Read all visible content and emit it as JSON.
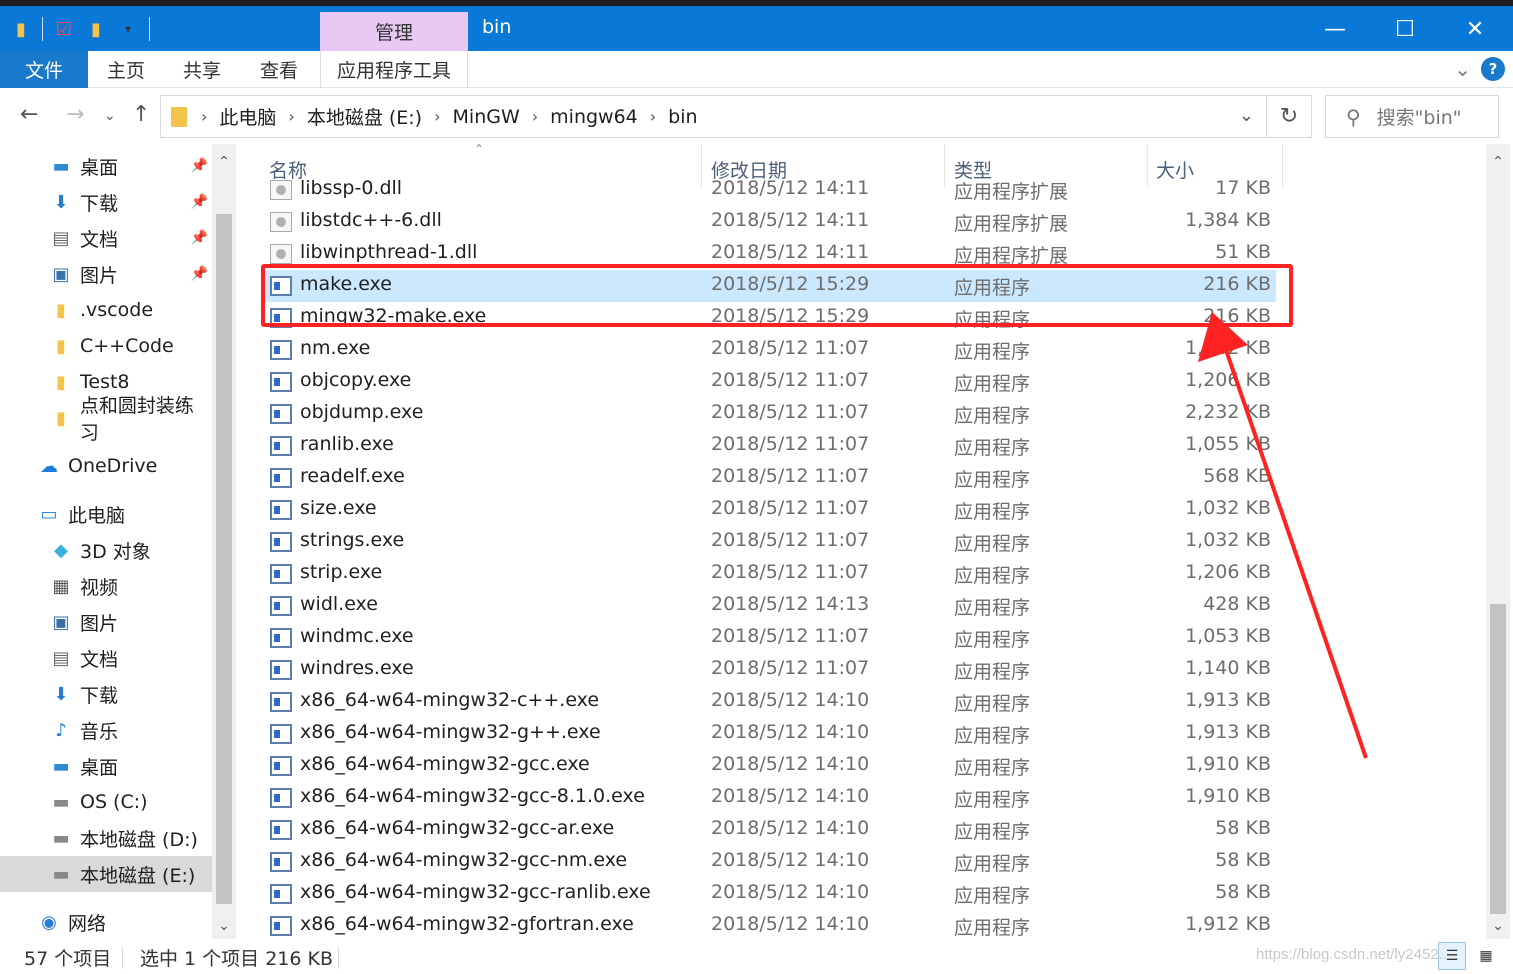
{
  "window": {
    "title": "bin",
    "context_tab": "管理",
    "controls": {
      "minimize": "—",
      "maximize": "☐",
      "close": "✕"
    }
  },
  "ribbon": {
    "tabs": [
      "文件",
      "主页",
      "共享",
      "查看",
      "应用程序工具"
    ],
    "help_label": "?"
  },
  "address": {
    "crumbs": [
      "此电脑",
      "本地磁盘 (E:)",
      "MinGW",
      "mingw64",
      "bin"
    ],
    "search_placeholder": "搜索\"bin\""
  },
  "nav": {
    "items": [
      {
        "label": "桌面",
        "icon": "desktop-icon",
        "pinned": true
      },
      {
        "label": "下载",
        "icon": "download-icon",
        "pinned": true
      },
      {
        "label": "文档",
        "icon": "document-icon",
        "pinned": true
      },
      {
        "label": "图片",
        "icon": "picture-icon",
        "pinned": true
      },
      {
        "label": ".vscode",
        "icon": "folder-icon",
        "pinned": false
      },
      {
        "label": "C++Code",
        "icon": "folder-icon",
        "pinned": false
      },
      {
        "label": "Test8",
        "icon": "folder-icon",
        "pinned": false
      },
      {
        "label": "点和圆封装练习",
        "icon": "folder-icon",
        "pinned": false
      },
      {
        "label": "OneDrive",
        "icon": "cloud-icon",
        "pinned": false
      },
      {
        "label": "此电脑",
        "icon": "computer-icon",
        "pinned": false
      },
      {
        "label": "3D 对象",
        "icon": "cube-icon",
        "pinned": false
      },
      {
        "label": "视频",
        "icon": "video-icon",
        "pinned": false
      },
      {
        "label": "图片",
        "icon": "picture-icon",
        "pinned": false
      },
      {
        "label": "文档",
        "icon": "document-icon",
        "pinned": false
      },
      {
        "label": "下载",
        "icon": "download-icon",
        "pinned": false
      },
      {
        "label": "音乐",
        "icon": "music-icon",
        "pinned": false
      },
      {
        "label": "桌面",
        "icon": "desktop-icon",
        "pinned": false
      },
      {
        "label": "OS (C:)",
        "icon": "drive-icon",
        "pinned": false
      },
      {
        "label": "本地磁盘 (D:)",
        "icon": "drive-icon",
        "pinned": false
      },
      {
        "label": "本地磁盘 (E:)",
        "icon": "drive-icon",
        "pinned": false,
        "selected": true
      },
      {
        "label": "网络",
        "icon": "network-icon",
        "pinned": false
      }
    ]
  },
  "columns": {
    "name": "名称",
    "date": "修改日期",
    "type": "类型",
    "size": "大小"
  },
  "files": [
    {
      "name": "libssp-0.dll",
      "date": "2018/5/12 14:11",
      "type": "应用程序扩展",
      "size": "17 KB",
      "kind": "dll"
    },
    {
      "name": "libstdc++-6.dll",
      "date": "2018/5/12 14:11",
      "type": "应用程序扩展",
      "size": "1,384 KB",
      "kind": "dll"
    },
    {
      "name": "libwinpthread-1.dll",
      "date": "2018/5/12 14:11",
      "type": "应用程序扩展",
      "size": "51 KB",
      "kind": "dll"
    },
    {
      "name": "make.exe",
      "date": "2018/5/12 15:29",
      "type": "应用程序",
      "size": "216 KB",
      "kind": "exe",
      "selected": true
    },
    {
      "name": "mingw32-make.exe",
      "date": "2018/5/12 15:29",
      "type": "应用程序",
      "size": "216 KB",
      "kind": "exe"
    },
    {
      "name": "nm.exe",
      "date": "2018/5/12 11:07",
      "type": "应用程序",
      "size": "1,042 KB",
      "kind": "exe"
    },
    {
      "name": "objcopy.exe",
      "date": "2018/5/12 11:07",
      "type": "应用程序",
      "size": "1,206 KB",
      "kind": "exe"
    },
    {
      "name": "objdump.exe",
      "date": "2018/5/12 11:07",
      "type": "应用程序",
      "size": "2,232 KB",
      "kind": "exe"
    },
    {
      "name": "ranlib.exe",
      "date": "2018/5/12 11:07",
      "type": "应用程序",
      "size": "1,055 KB",
      "kind": "exe"
    },
    {
      "name": "readelf.exe",
      "date": "2018/5/12 11:07",
      "type": "应用程序",
      "size": "568 KB",
      "kind": "exe"
    },
    {
      "name": "size.exe",
      "date": "2018/5/12 11:07",
      "type": "应用程序",
      "size": "1,032 KB",
      "kind": "exe"
    },
    {
      "name": "strings.exe",
      "date": "2018/5/12 11:07",
      "type": "应用程序",
      "size": "1,032 KB",
      "kind": "exe"
    },
    {
      "name": "strip.exe",
      "date": "2018/5/12 11:07",
      "type": "应用程序",
      "size": "1,206 KB",
      "kind": "exe"
    },
    {
      "name": "widl.exe",
      "date": "2018/5/12 14:13",
      "type": "应用程序",
      "size": "428 KB",
      "kind": "exe"
    },
    {
      "name": "windmc.exe",
      "date": "2018/5/12 11:07",
      "type": "应用程序",
      "size": "1,053 KB",
      "kind": "exe"
    },
    {
      "name": "windres.exe",
      "date": "2018/5/12 11:07",
      "type": "应用程序",
      "size": "1,140 KB",
      "kind": "exe"
    },
    {
      "name": "x86_64-w64-mingw32-c++.exe",
      "date": "2018/5/12 14:10",
      "type": "应用程序",
      "size": "1,913 KB",
      "kind": "exe"
    },
    {
      "name": "x86_64-w64-mingw32-g++.exe",
      "date": "2018/5/12 14:10",
      "type": "应用程序",
      "size": "1,913 KB",
      "kind": "exe"
    },
    {
      "name": "x86_64-w64-mingw32-gcc.exe",
      "date": "2018/5/12 14:10",
      "type": "应用程序",
      "size": "1,910 KB",
      "kind": "exe"
    },
    {
      "name": "x86_64-w64-mingw32-gcc-8.1.0.exe",
      "date": "2018/5/12 14:10",
      "type": "应用程序",
      "size": "1,910 KB",
      "kind": "exe"
    },
    {
      "name": "x86_64-w64-mingw32-gcc-ar.exe",
      "date": "2018/5/12 14:10",
      "type": "应用程序",
      "size": "58 KB",
      "kind": "exe"
    },
    {
      "name": "x86_64-w64-mingw32-gcc-nm.exe",
      "date": "2018/5/12 14:10",
      "type": "应用程序",
      "size": "58 KB",
      "kind": "exe"
    },
    {
      "name": "x86_64-w64-mingw32-gcc-ranlib.exe",
      "date": "2018/5/12 14:10",
      "type": "应用程序",
      "size": "58 KB",
      "kind": "exe"
    },
    {
      "name": "x86_64-w64-mingw32-gfortran.exe",
      "date": "2018/5/12 14:10",
      "type": "应用程序",
      "size": "1,912 KB",
      "kind": "exe"
    }
  ],
  "status": {
    "count": "57 个项目",
    "selection": "选中 1 个项目  216 KB"
  },
  "watermark": "https://blog.csdn.net/ly2452...",
  "colors": {
    "accent": "#0a78d7",
    "selection": "#cce8ff",
    "annotation": "#ff2222"
  }
}
